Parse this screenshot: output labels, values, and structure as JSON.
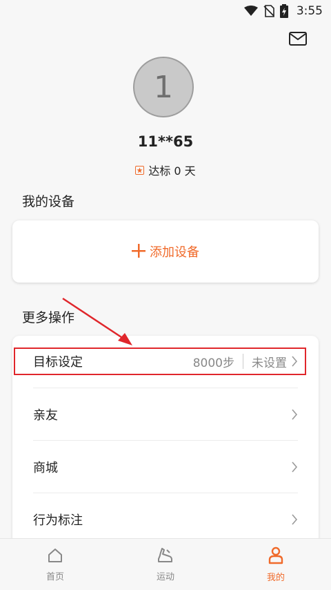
{
  "status_bar": {
    "time": "3:55",
    "icons": [
      "wifi-icon",
      "no-sim-icon",
      "battery-charging-icon"
    ]
  },
  "header": {
    "mail_icon": "mail-icon"
  },
  "profile": {
    "avatar_text": "1",
    "username": "11**65",
    "goal_days_text": "达标 0 天"
  },
  "devices": {
    "section_title": "我的设备",
    "add_device_label": "添加设备"
  },
  "more": {
    "section_title": "更多操作",
    "items": [
      {
        "label": "目标设定",
        "value": "8000步",
        "status": "未设置"
      },
      {
        "label": "亲友"
      },
      {
        "label": "商城"
      },
      {
        "label": "行为标注"
      }
    ]
  },
  "bottom_nav": {
    "items": [
      {
        "label": "首页",
        "icon": "home-icon",
        "active": false
      },
      {
        "label": "运动",
        "icon": "shoe-icon",
        "active": false
      },
      {
        "label": "我的",
        "icon": "person-icon",
        "active": true
      }
    ]
  },
  "colors": {
    "accent": "#f06a2a",
    "annotation": "#e0262b"
  }
}
